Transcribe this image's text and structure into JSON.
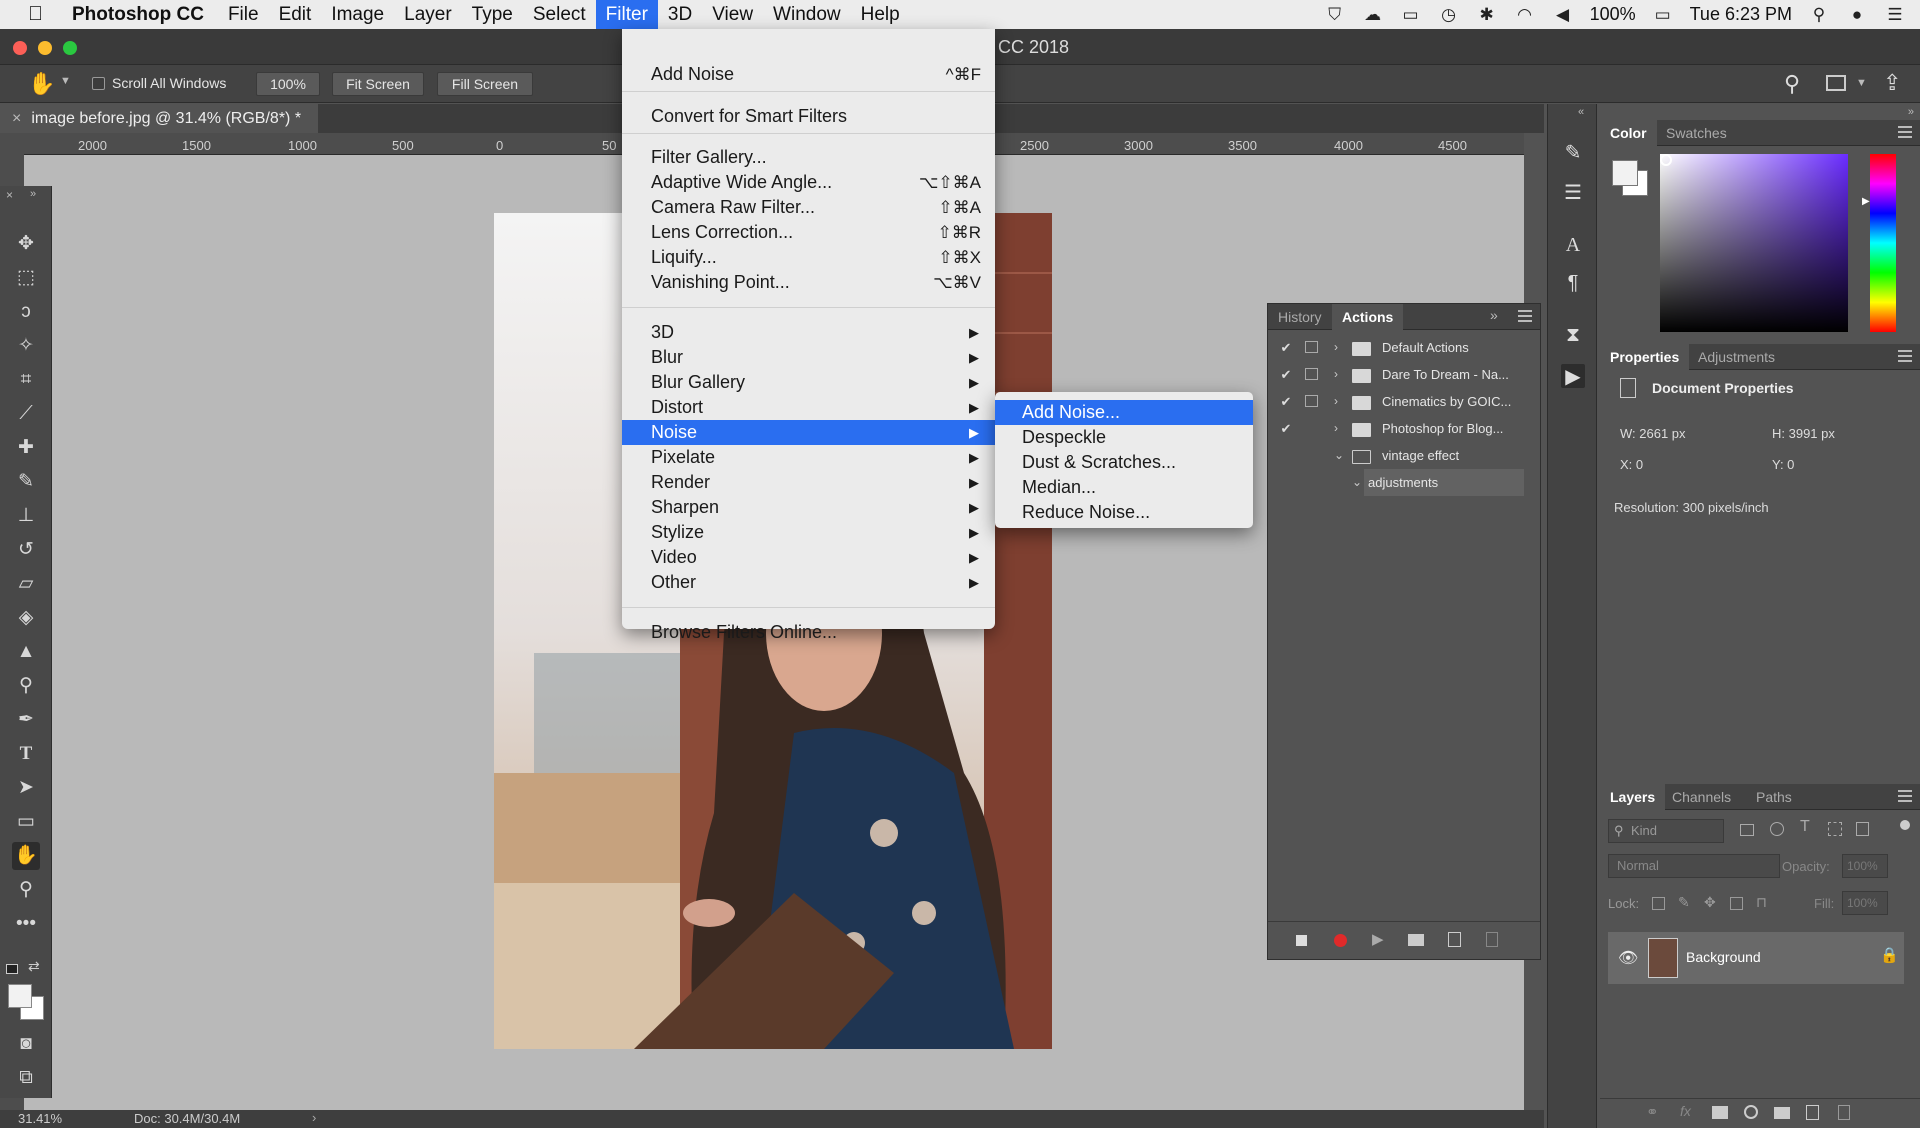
{
  "menubar": {
    "app": "Photoshop CC",
    "items": [
      "File",
      "Edit",
      "Image",
      "Layer",
      "Type",
      "Select",
      "Filter",
      "3D",
      "View",
      "Window",
      "Help"
    ],
    "active": "Filter",
    "battery": "100%",
    "clock": "Tue 6:23 PM"
  },
  "window": {
    "title_visible": "CC 2018"
  },
  "options": {
    "scroll_all_label": "Scroll All Windows",
    "zoom_value": "100%",
    "fit_label": "Fit Screen",
    "fill_label": "Fill Screen"
  },
  "document": {
    "tab": "image before.jpg @ 31.4% (RGB/8*) *"
  },
  "ruler": [
    "2000",
    "1500",
    "1000",
    "500",
    "0",
    "50",
    "2500",
    "3000",
    "3500",
    "4000",
    "4500"
  ],
  "filter_menu": {
    "items": [
      {
        "label": "Add Noise",
        "shortcut": "^⌘F"
      },
      {
        "label": "Convert for Smart Filters",
        "shortcut": ""
      },
      {
        "label": "Filter Gallery...",
        "shortcut": ""
      },
      {
        "label": "Adaptive Wide Angle...",
        "shortcut": "⌥⇧⌘A"
      },
      {
        "label": "Camera Raw Filter...",
        "shortcut": "⇧⌘A"
      },
      {
        "label": "Lens Correction...",
        "shortcut": "⇧⌘R"
      },
      {
        "label": "Liquify...",
        "shortcut": "⇧⌘X"
      },
      {
        "label": "Vanishing Point...",
        "shortcut": "⌥⌘V"
      },
      {
        "label": "3D",
        "shortcut": "▶"
      },
      {
        "label": "Blur",
        "shortcut": "▶"
      },
      {
        "label": "Blur Gallery",
        "shortcut": "▶"
      },
      {
        "label": "Distort",
        "shortcut": "▶"
      },
      {
        "label": "Noise",
        "shortcut": "▶"
      },
      {
        "label": "Pixelate",
        "shortcut": "▶"
      },
      {
        "label": "Render",
        "shortcut": "▶"
      },
      {
        "label": "Sharpen",
        "shortcut": "▶"
      },
      {
        "label": "Stylize",
        "shortcut": "▶"
      },
      {
        "label": "Video",
        "shortcut": "▶"
      },
      {
        "label": "Other",
        "shortcut": "▶"
      },
      {
        "label": "Browse Filters Online...",
        "shortcut": ""
      }
    ]
  },
  "noise_submenu": [
    "Add Noise...",
    "Despeckle",
    "Dust & Scratches...",
    "Median...",
    "Reduce Noise..."
  ],
  "actions_panel": {
    "tabs": [
      "History",
      "Actions"
    ],
    "items": [
      "Default Actions",
      "Dare To Dream - Na...",
      "Cinematics by GOIC...",
      "Photoshop for Blog...",
      "vintage effect",
      "adjustments"
    ]
  },
  "color_panel": {
    "tabs": [
      "Color",
      "Swatches"
    ]
  },
  "properties_panel": {
    "tabs": [
      "Properties",
      "Adjustments"
    ],
    "heading": "Document Properties",
    "w": "W:  2661 px",
    "h": "H:  3991 px",
    "x": "X:  0",
    "y": "Y:  0",
    "resolution": "Resolution: 300 pixels/inch"
  },
  "layers_panel": {
    "tabs": [
      "Layers",
      "Channels",
      "Paths"
    ],
    "kind": "Kind",
    "blend": "Normal",
    "opacity_label": "Opacity:",
    "opacity": "100%",
    "lock_label": "Lock:",
    "fill_label": "Fill:",
    "fill": "100%",
    "layer": "Background"
  },
  "status": {
    "zoom": "31.41%",
    "doc": "Doc: 30.4M/30.4M"
  }
}
